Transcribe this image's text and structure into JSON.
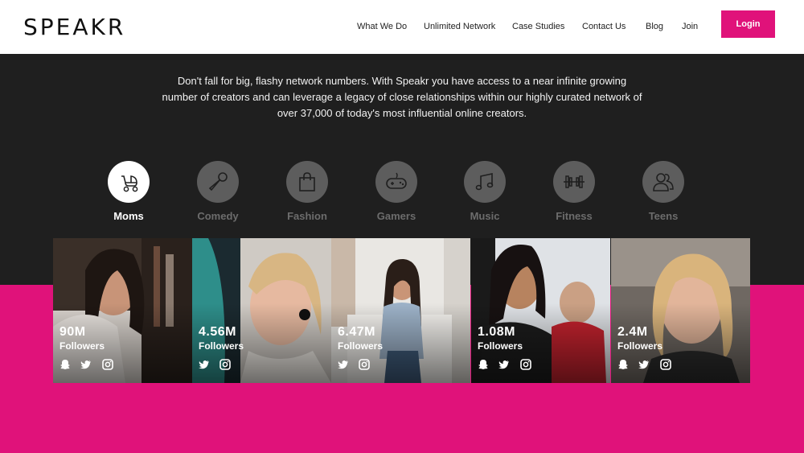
{
  "header": {
    "logo": "SPEAKR",
    "nav": [
      "What We Do",
      "Unlimited Network",
      "Case Studies",
      "Contact Us",
      "Blog",
      "Join"
    ],
    "login_label": "Login"
  },
  "intro": {
    "text": "Don't fall for big, flashy network numbers. With Speakr you have access to a near infinite growing number of creators and can leverage a legacy of close relationships within our highly curated network of over 37,000 of today's most influential online creators."
  },
  "categories": [
    {
      "label": "Moms",
      "icon": "stroller-icon",
      "active": true
    },
    {
      "label": "Comedy",
      "icon": "microphone-icon",
      "active": false
    },
    {
      "label": "Fashion",
      "icon": "shopping-bag-icon",
      "active": false
    },
    {
      "label": "Gamers",
      "icon": "gamepad-icon",
      "active": false
    },
    {
      "label": "Music",
      "icon": "music-note-icon",
      "active": false
    },
    {
      "label": "Fitness",
      "icon": "dumbbell-icon",
      "active": false
    },
    {
      "label": "Teens",
      "icon": "people-icon",
      "active": false
    }
  ],
  "creators": [
    {
      "followers": "90M",
      "label": "Followers",
      "socials": [
        "snapchat-icon",
        "twitter-icon",
        "instagram-icon"
      ]
    },
    {
      "followers": "4.56M",
      "label": "Followers",
      "socials": [
        "twitter-icon",
        "instagram-icon"
      ]
    },
    {
      "followers": "6.47M",
      "label": "Followers",
      "socials": [
        "twitter-icon",
        "instagram-icon"
      ]
    },
    {
      "followers": "1.08M",
      "label": "Followers",
      "socials": [
        "snapchat-icon",
        "twitter-icon",
        "instagram-icon"
      ]
    },
    {
      "followers": "2.4M",
      "label": "Followers",
      "socials": [
        "snapchat-icon",
        "twitter-icon",
        "instagram-icon"
      ]
    }
  ],
  "colors": {
    "accent": "#e0127a",
    "dark": "#1f1f1f",
    "inactive": "#5d5d5d"
  }
}
